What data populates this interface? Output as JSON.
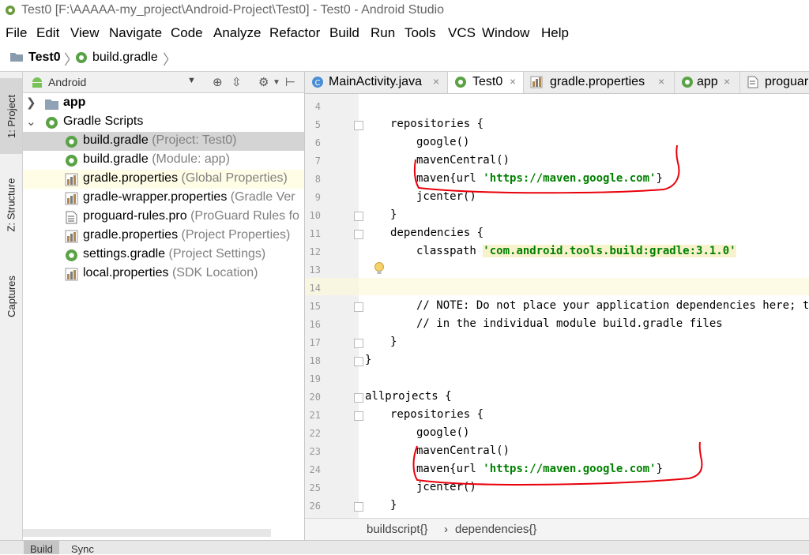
{
  "window": {
    "title": "Test0 [F:\\AAAAA-my_project\\Android-Project\\Test0] - Test0 - Android Studio"
  },
  "menu": [
    "File",
    "Edit",
    "View",
    "Navigate",
    "Code",
    "Analyze",
    "Refactor",
    "Build",
    "Run",
    "Tools",
    "VCS",
    "Window",
    "Help"
  ],
  "nav": {
    "project": "Test0",
    "file": "build.gradle"
  },
  "left_tabs": [
    "1: Project",
    "Z: Structure",
    "Captures"
  ],
  "project_panel": {
    "view": "Android",
    "tree": [
      {
        "name": "app",
        "hint": "",
        "icon": "folder-icon"
      },
      {
        "name": "Gradle Scripts",
        "hint": "",
        "icon": "gradle-icon"
      },
      {
        "name": "build.gradle",
        "hint": "(Project: Test0)",
        "icon": "gradle-icon"
      },
      {
        "name": "build.gradle",
        "hint": "(Module: app)",
        "icon": "gradle-icon"
      },
      {
        "name": "gradle.properties",
        "hint": "(Global Properties)",
        "icon": "properties-icon"
      },
      {
        "name": "gradle-wrapper.properties",
        "hint": "(Gradle Ver",
        "icon": "properties-icon"
      },
      {
        "name": "proguard-rules.pro",
        "hint": "(ProGuard Rules fo",
        "icon": "file-icon"
      },
      {
        "name": "gradle.properties",
        "hint": "(Project Properties)",
        "icon": "properties-icon"
      },
      {
        "name": "settings.gradle",
        "hint": "(Project Settings)",
        "icon": "gradle-icon"
      },
      {
        "name": "local.properties",
        "hint": "(SDK Location)",
        "icon": "properties-icon"
      }
    ]
  },
  "tabs": [
    {
      "label": "MainActivity.java",
      "icon": "java-class-icon"
    },
    {
      "label": "Test0",
      "icon": "gradle-icon"
    },
    {
      "label": "gradle.properties",
      "icon": "properties-icon"
    },
    {
      "label": "app",
      "icon": "gradle-icon"
    },
    {
      "label": "proguar",
      "icon": "file-icon"
    }
  ],
  "close_glyph": "×",
  "editor": {
    "line_numbers": [
      "4",
      "5",
      "6",
      "7",
      "8",
      "9",
      "10",
      "11",
      "12",
      "13",
      "14",
      "15",
      "16",
      "17",
      "18",
      "19",
      "20",
      "21",
      "22",
      "23",
      "24",
      "25",
      "26"
    ],
    "code": {
      "l5": "repositories {",
      "l6": "google()",
      "l7": "mavenCentral()",
      "l8_pre": "maven{url ",
      "l8_str": "'https://maven.google.com'",
      "l8_post": "}",
      "l9": "jcenter()",
      "l10": "}",
      "l11": "dependencies {",
      "l12_pre": "classpath ",
      "l12_str": "'com.android.tools.build:gradle:3.1.0'",
      "l15": "// NOTE: Do not place your application dependencies here; they",
      "l16": "// in the individual module build.gradle files",
      "l17": "}",
      "l18": "}",
      "l20": "allprojects {",
      "l21": "repositories {",
      "l22": "google()",
      "l23": "mavenCentral()",
      "l24_pre": "maven{url ",
      "l24_str": "'https://maven.google.com'",
      "l24_post": "}",
      "l25": "jcenter()",
      "l26": "}"
    },
    "breadcrumbs": [
      "buildscript{}",
      "dependencies{}"
    ],
    "breadcrumb_sep": "›"
  },
  "bottom_tabs": [
    "Build",
    "Sync"
  ],
  "colors": {
    "annotation": "#e8000b",
    "string": "#008000",
    "selected_row": "#d4d4d4"
  }
}
